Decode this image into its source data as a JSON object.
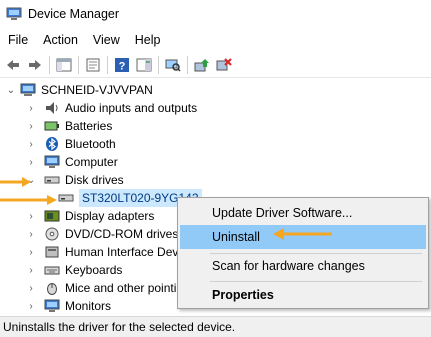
{
  "window": {
    "title": "Device Manager"
  },
  "menu": [
    "File",
    "Action",
    "View",
    "Help"
  ],
  "toolbar": {
    "icons": [
      "back-arrow-icon",
      "forward-arrow-icon",
      "show-hide-console-tree-icon",
      "properties-icon",
      "help-icon",
      "action-pane-icon",
      "scan-hardware-icon",
      "update-driver-icon",
      "uninstall-device-icon"
    ]
  },
  "tree": {
    "root": "SCHNEID-VJVVPAN",
    "items": [
      {
        "label": "Audio inputs and outputs",
        "expanded": false
      },
      {
        "label": "Batteries",
        "expanded": false
      },
      {
        "label": "Bluetooth",
        "expanded": false
      },
      {
        "label": "Computer",
        "expanded": false
      },
      {
        "label": "Disk drives",
        "expanded": true
      },
      {
        "label": "ST320LT020-9YG142",
        "child": true,
        "selected": true
      },
      {
        "label": "Display adapters",
        "expanded": false
      },
      {
        "label": "DVD/CD-ROM drives",
        "expanded": false
      },
      {
        "label": "Human Interface Dev",
        "expanded": false
      },
      {
        "label": "Keyboards",
        "expanded": false
      },
      {
        "label": "Mice and other pointi",
        "expanded": false
      },
      {
        "label": "Monitors",
        "expanded": false
      }
    ]
  },
  "context_menu": {
    "update": "Update Driver Software...",
    "uninstall": "Uninstall",
    "scan": "Scan for hardware changes",
    "properties": "Properties"
  },
  "status": {
    "text": "Uninstalls the driver for the selected device."
  },
  "colors": {
    "accent": "#f5a623",
    "highlight": "#91c9f7",
    "selection": "#cce8ff"
  }
}
